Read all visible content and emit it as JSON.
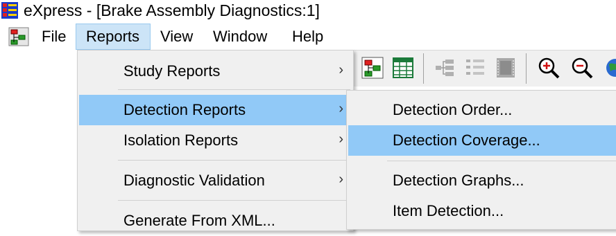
{
  "window": {
    "title": "eXpress - [Brake Assembly Diagnostics:1]",
    "app_icon": "express-app-icon"
  },
  "menubar": {
    "icon": "document-diagram-icon",
    "items": [
      "File",
      "Reports",
      "View",
      "Window",
      "Help"
    ],
    "active": "Reports"
  },
  "reports_menu": {
    "items": [
      {
        "label": "Study Reports",
        "submenu": true
      },
      {
        "label": "Detection Reports",
        "submenu": true,
        "highlighted": true
      },
      {
        "label": "Isolation Reports",
        "submenu": true
      },
      {
        "label": "Diagnostic Validation",
        "submenu": true
      },
      {
        "label": "Generate From XML...",
        "submenu": false
      }
    ],
    "arrow": "›"
  },
  "detection_submenu": {
    "items": [
      {
        "label": "Detection Order..."
      },
      {
        "label": "Detection Coverage...",
        "highlighted": true
      },
      {
        "label": "Detection Graphs..."
      },
      {
        "label": "Item Detection..."
      }
    ]
  },
  "toolbar": {
    "icons": [
      "diagram-icon",
      "table-icon",
      "tree-left-icon",
      "tree-list-icon",
      "film-icon",
      "zoom-in-icon",
      "zoom-out-icon",
      "globe-icon"
    ]
  },
  "colors": {
    "menu_highlight": "#91c9f7",
    "menubar_active": "#cce4f7",
    "menu_background": "#f0f0f0"
  }
}
